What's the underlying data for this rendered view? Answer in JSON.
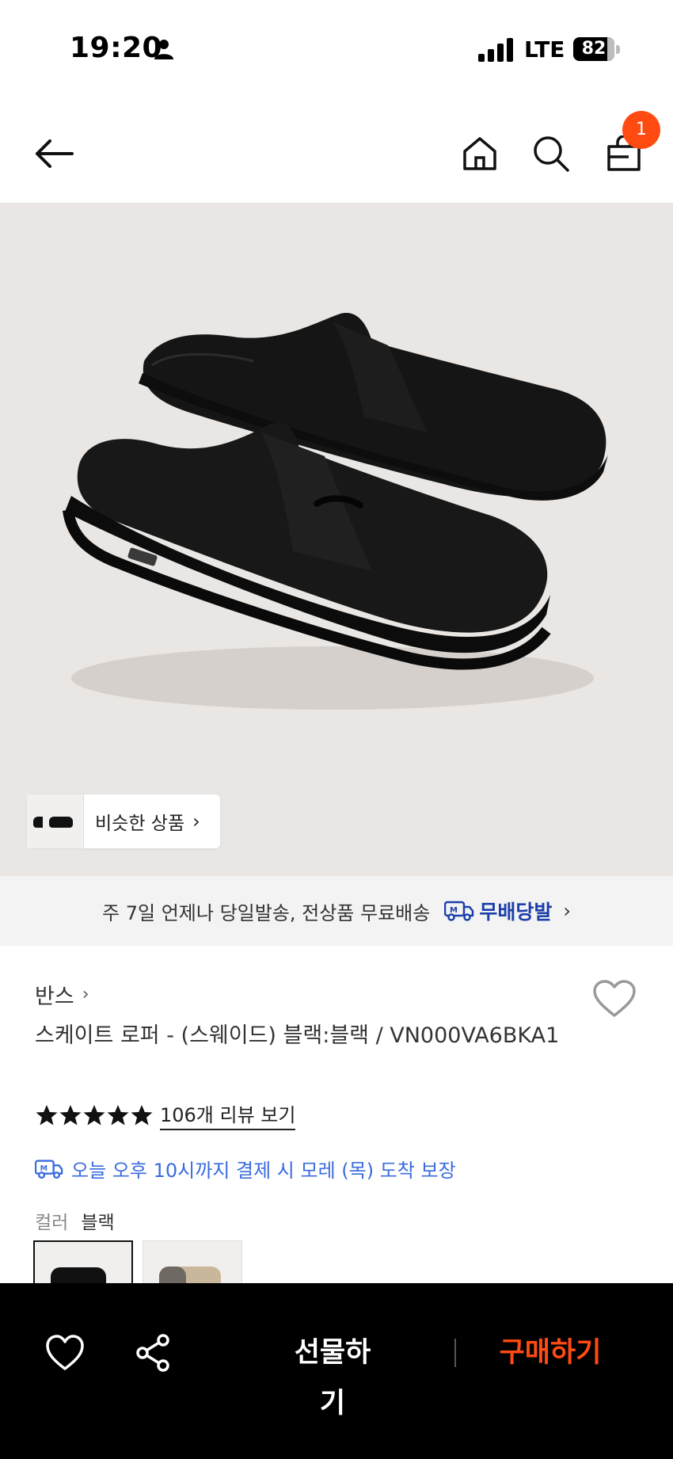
{
  "status_bar": {
    "time": "19:20",
    "network": "LTE",
    "battery_percent": "82",
    "battery_level": 0.82,
    "icons": [
      "person-icon",
      "signal-icon",
      "battery-icon"
    ]
  },
  "top_nav": {
    "icons": [
      "back-arrow-icon",
      "home-icon",
      "search-icon",
      "shopping-bag-icon"
    ],
    "cart_count": "1",
    "accent_color": "#ff4b12"
  },
  "hero": {
    "background_color": "#e9e6e3",
    "image_subject": "black suede loafers",
    "similar_button_label": "비슷한 상품"
  },
  "shipping_banner": {
    "text": "주 7일 언제나 당일발송, 전상품 무료배송",
    "badge_label": "무배당발",
    "badge_color": "#1c3faa"
  },
  "product": {
    "brand": "반스",
    "title": "스케이트 로퍼 - (스웨이드) 블랙:블랙 / VN000VA6BKA1",
    "rating_stars": 5,
    "reviews_label": "106개 리뷰 보기",
    "delivery_promise": "오늘 오후 10시까지 결제 시 모레 (목) 도착 보장",
    "delivery_color": "#3a6bdd",
    "color_label": "컬러",
    "color_value": "블랙"
  },
  "bottom_bar": {
    "gift_label": "선물하기",
    "buy_label": "구매하기",
    "buy_color": "#ff4b12",
    "icons": [
      "heart-icon",
      "share-icon"
    ]
  }
}
